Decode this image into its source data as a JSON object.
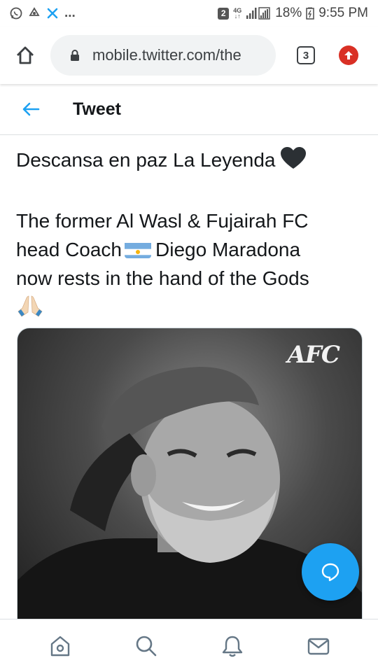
{
  "status_bar": {
    "notification_count": "2",
    "network_type": "4G",
    "battery_percent": "18%",
    "time": "9:55 PM",
    "left_icons": [
      "whatsapp-icon",
      "recycle-icon",
      "x-icon",
      "more-dots"
    ],
    "more_indicator": "..."
  },
  "browser": {
    "url": "mobile.twitter.com/the",
    "tab_count": "3",
    "icons": [
      "home-icon",
      "lock-icon",
      "tabs-icon",
      "update-arrow-icon"
    ]
  },
  "header": {
    "title": "Tweet",
    "back_icon": "back-arrow-icon"
  },
  "tweet": {
    "line1": "Descansa en paz La Leyenda",
    "line1_emoji": "black-heart-icon",
    "line2": "The former Al Wasl & Fujairah FC",
    "line3_a": "head Coach",
    "line3_flag": "argentina-flag-icon",
    "line3_b": "Diego Maradona",
    "line4": "now rests in the hand of the Gods",
    "line5_emoji": "folded-hands-icon"
  },
  "media": {
    "logo_text": "AFC"
  },
  "fab": {
    "icon": "compose-reply-icon"
  },
  "bottom_nav": {
    "items": [
      "home-icon",
      "search-icon",
      "notifications-bell-icon",
      "messages-envelope-icon"
    ]
  },
  "colors": {
    "twitter_blue": "#1da1f2",
    "text": "#14171a",
    "update_red": "#d93025",
    "flag_blue": "#74acdf",
    "flag_sun": "#f6b40e"
  }
}
